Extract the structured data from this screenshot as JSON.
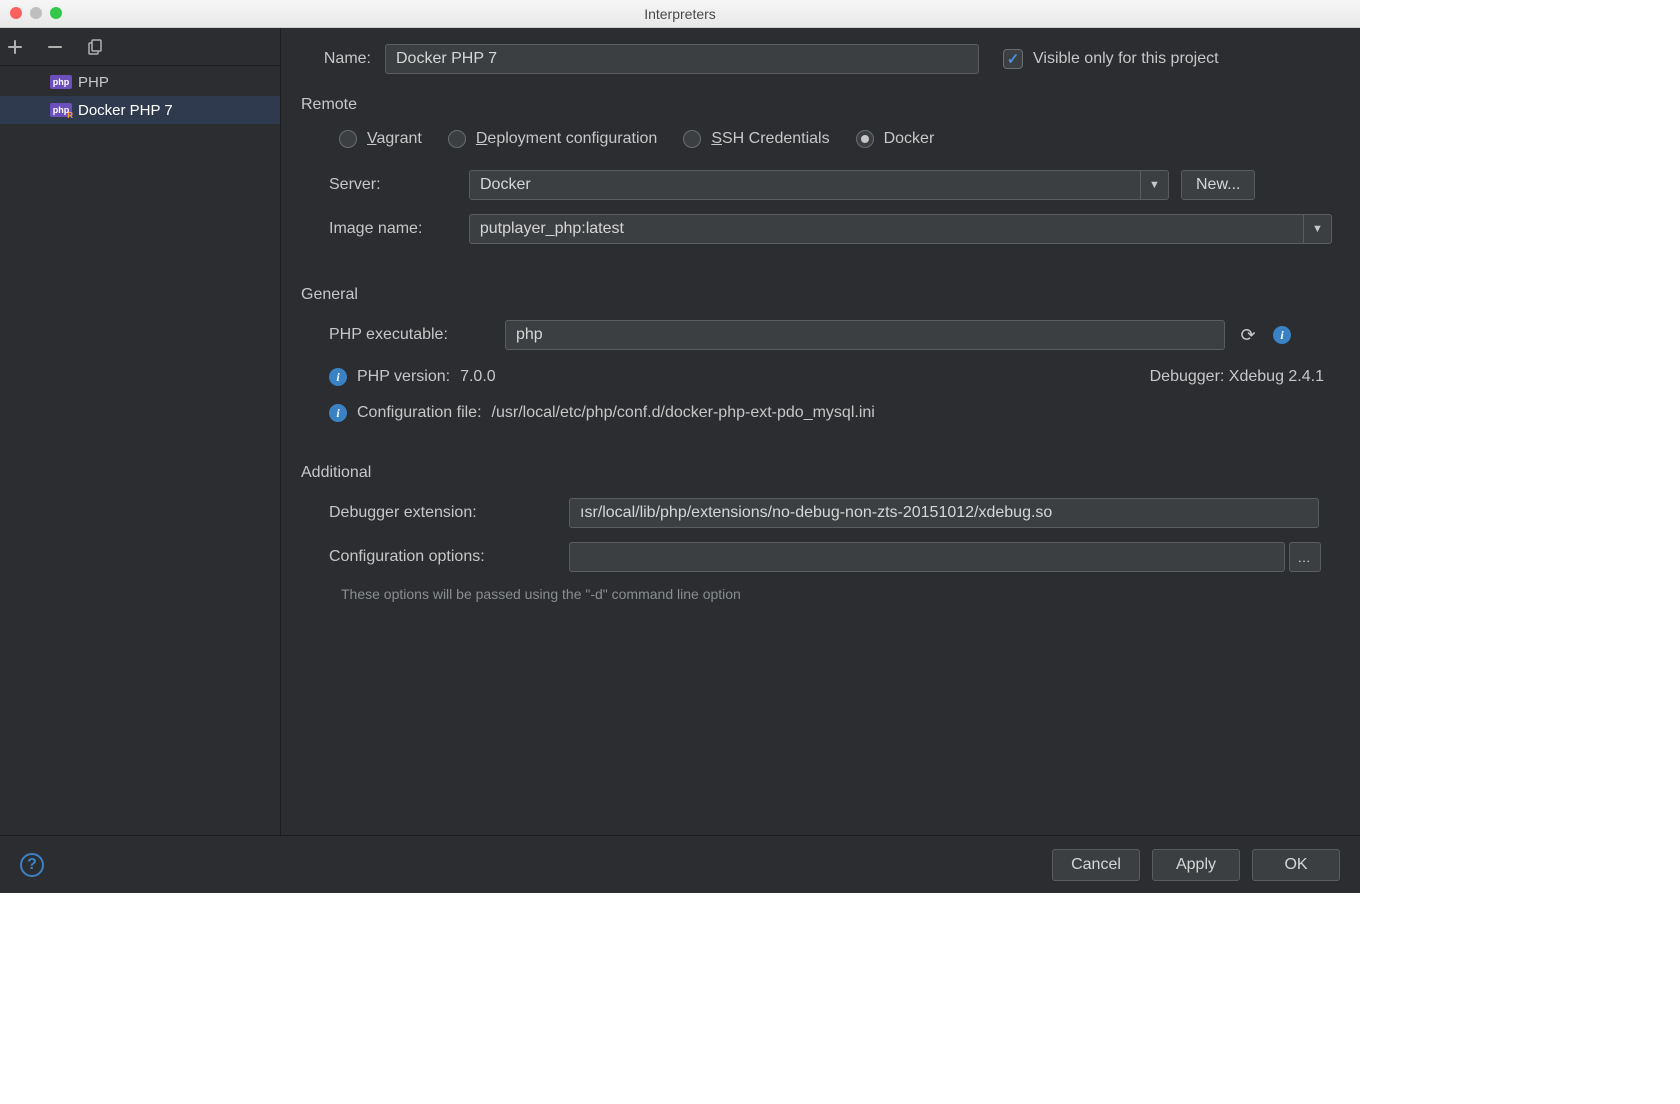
{
  "window": {
    "title": "Interpreters"
  },
  "sidebar": {
    "items": [
      {
        "label": "PHP",
        "selected": false
      },
      {
        "label": "Docker PHP 7",
        "selected": true
      }
    ]
  },
  "form": {
    "name_label": "Name:",
    "name_value": "Docker PHP 7",
    "visible_only_label": "Visible only for this project",
    "visible_only_checked": true
  },
  "remote": {
    "header": "Remote",
    "options": {
      "vagrant": "Vagrant",
      "deployment": "Deployment configuration",
      "ssh": "SSH Credentials",
      "docker": "Docker"
    },
    "selected": "docker",
    "server_label": "Server:",
    "server_value": "Docker",
    "new_button": "New...",
    "image_label": "Image name:",
    "image_value": "putplayer_php:latest"
  },
  "general": {
    "header": "General",
    "php_exec_label": "PHP executable:",
    "php_exec_value": "php",
    "php_version_label": "PHP version:",
    "php_version_value": "7.0.0",
    "debugger_label": "Debugger:",
    "debugger_value": "Xdebug 2.4.1",
    "config_file_label": "Configuration file:",
    "config_file_value": "/usr/local/etc/php/conf.d/docker-php-ext-pdo_mysql.ini"
  },
  "additional": {
    "header": "Additional",
    "debugger_ext_label": "Debugger extension:",
    "debugger_ext_value": "ısr/local/lib/php/extensions/no-debug-non-zts-20151012/xdebug.so",
    "config_options_label": "Configuration options:",
    "config_options_value": "",
    "hint": "These options will be passed using the \"-d\" command line option"
  },
  "footer": {
    "cancel": "Cancel",
    "apply": "Apply",
    "ok": "OK"
  }
}
